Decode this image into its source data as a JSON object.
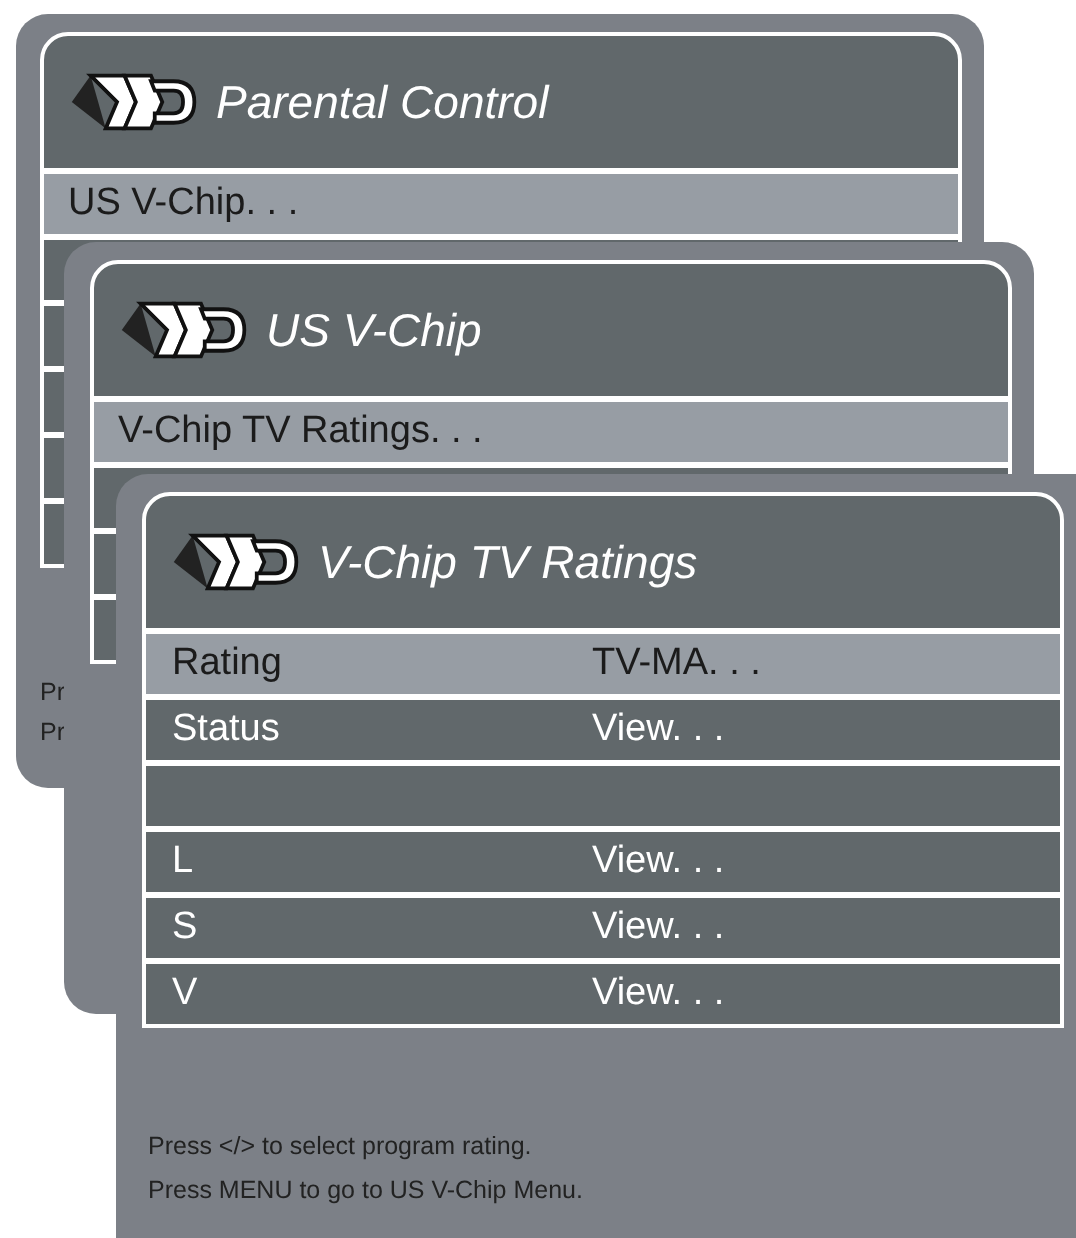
{
  "menus": [
    {
      "title": "Parental Control",
      "rows": [
        {
          "label": "US V-Chip. . .",
          "selected": true
        },
        {
          "selected": false
        },
        {
          "selected": false
        },
        {
          "selected": false
        },
        {
          "selected": false
        },
        {
          "selected": false
        }
      ],
      "hints": [
        "Pr",
        "Pr"
      ]
    },
    {
      "title": "US V-Chip",
      "rows": [
        {
          "label": "V-Chip TV Ratings. . .",
          "selected": true
        },
        {
          "selected": false
        },
        {
          "selected": false
        },
        {
          "selected": false
        }
      ]
    },
    {
      "title": "V-Chip TV Ratings",
      "rows": [
        {
          "label": "Rating",
          "value": "TV-MA. . .",
          "selected": true
        },
        {
          "label": "Status",
          "value": "View. . .",
          "selected": false
        },
        {
          "selected": false
        },
        {
          "label": "L",
          "value": "View. . .",
          "selected": false
        },
        {
          "label": "S",
          "value": "View. . .",
          "selected": false
        },
        {
          "label": "V",
          "value": "View. . .",
          "selected": false
        }
      ],
      "hints": [
        "Press </> to select program rating.",
        "Press MENU to go to US V-Chip Menu."
      ]
    }
  ]
}
